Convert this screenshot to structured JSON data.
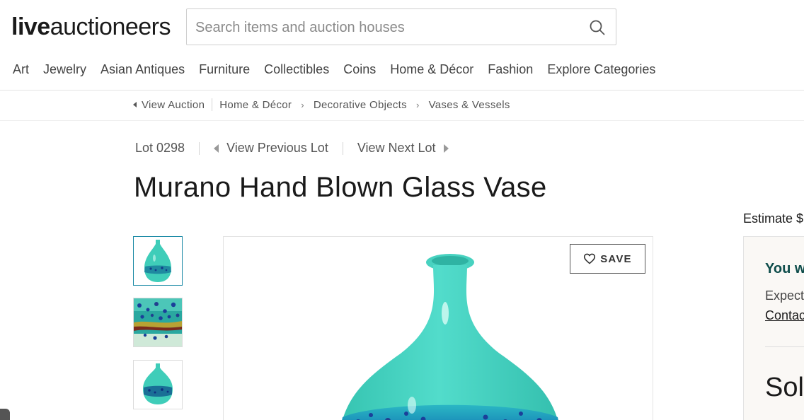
{
  "header": {
    "logo": {
      "bold": "live",
      "light": "auctioneers"
    },
    "search": {
      "placeholder": "Search items and auction houses"
    }
  },
  "nav": {
    "items": [
      "Art",
      "Jewelry",
      "Asian Antiques",
      "Furniture",
      "Collectibles",
      "Coins",
      "Home & Décor",
      "Fashion",
      "Explore Categories"
    ]
  },
  "breadcrumb": {
    "back": "View Auction",
    "crumbs": [
      "Home & Décor",
      "Decorative Objects",
      "Vases & Vessels"
    ]
  },
  "lot": {
    "number": "Lot 0298",
    "prev": "View Previous Lot",
    "next": "View Next Lot"
  },
  "title": "Murano Hand Blown Glass Vase",
  "save_label": "SAVE",
  "side": {
    "estimate": "Estimate $",
    "card_heading": "You w",
    "card_expect": "Expect",
    "card_contact": "Contac",
    "card_sold": "Sol"
  },
  "colors": {
    "brand_teal": "#0e4d4b",
    "thumb_active": "#1c8aa6",
    "glass_teal": "#3fcdb9"
  }
}
